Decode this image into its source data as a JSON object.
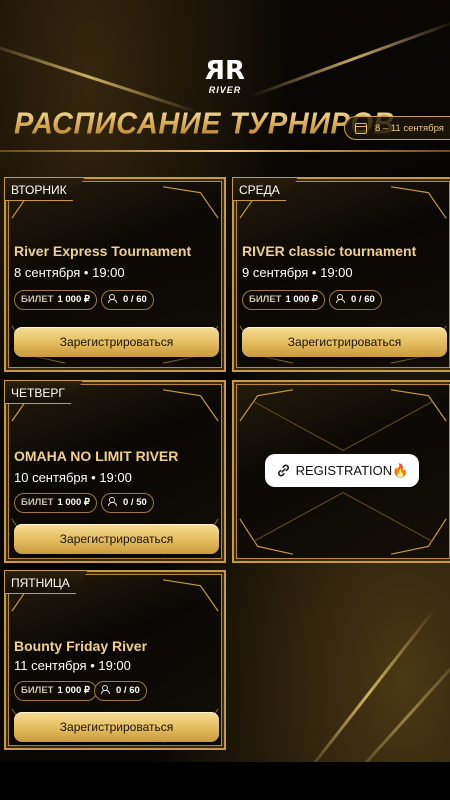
{
  "brand": {
    "mark": "RR",
    "name": "RIVER"
  },
  "header": {
    "title": "РАСПИСАНИЕ ТУРНИРОВ",
    "date_range": "8 – 11 сентября"
  },
  "cards": [
    {
      "day": "ВТОРНИК",
      "name": "River Express Tournament",
      "date": "8 сентября • 19:00",
      "ticket_label": "БИЛЕТ",
      "ticket_price": "1 000 ₽",
      "seats": "0 / 60",
      "button": "Зарегистрироваться"
    },
    {
      "day": "СРЕДА",
      "name": "RIVER classic tournament",
      "date": "9 сентября • 19:00",
      "ticket_label": "БИЛЕТ",
      "ticket_price": "1 000 ₽",
      "seats": "0 / 60",
      "button": "Зарегистрироваться"
    },
    {
      "day": "ЧЕТВЕРГ",
      "name": "OMAHA NO LIMIT RIVER",
      "date": "10 сентября • 19:00",
      "ticket_label": "БИЛЕТ",
      "ticket_price": "1 000 ₽",
      "seats": "0 / 50",
      "button": "Зарегистрироваться"
    },
    {
      "day": "ПЯТНИЦА",
      "name": "Bounty Friday River",
      "date": "11 сентября • 19:00",
      "ticket_label": "БИЛЕТ",
      "ticket_price": "1 000 ₽",
      "seats": "0 / 60",
      "button": "Зарегистрироваться"
    }
  ],
  "registration_badge": {
    "label": "REGISTRATION",
    "emoji": "🔥",
    "icon": "link-icon"
  },
  "colors": {
    "gold": "#c79a45",
    "button_gold": "#e5bf62",
    "title_gold": "#e8c371",
    "background": "#050402"
  }
}
